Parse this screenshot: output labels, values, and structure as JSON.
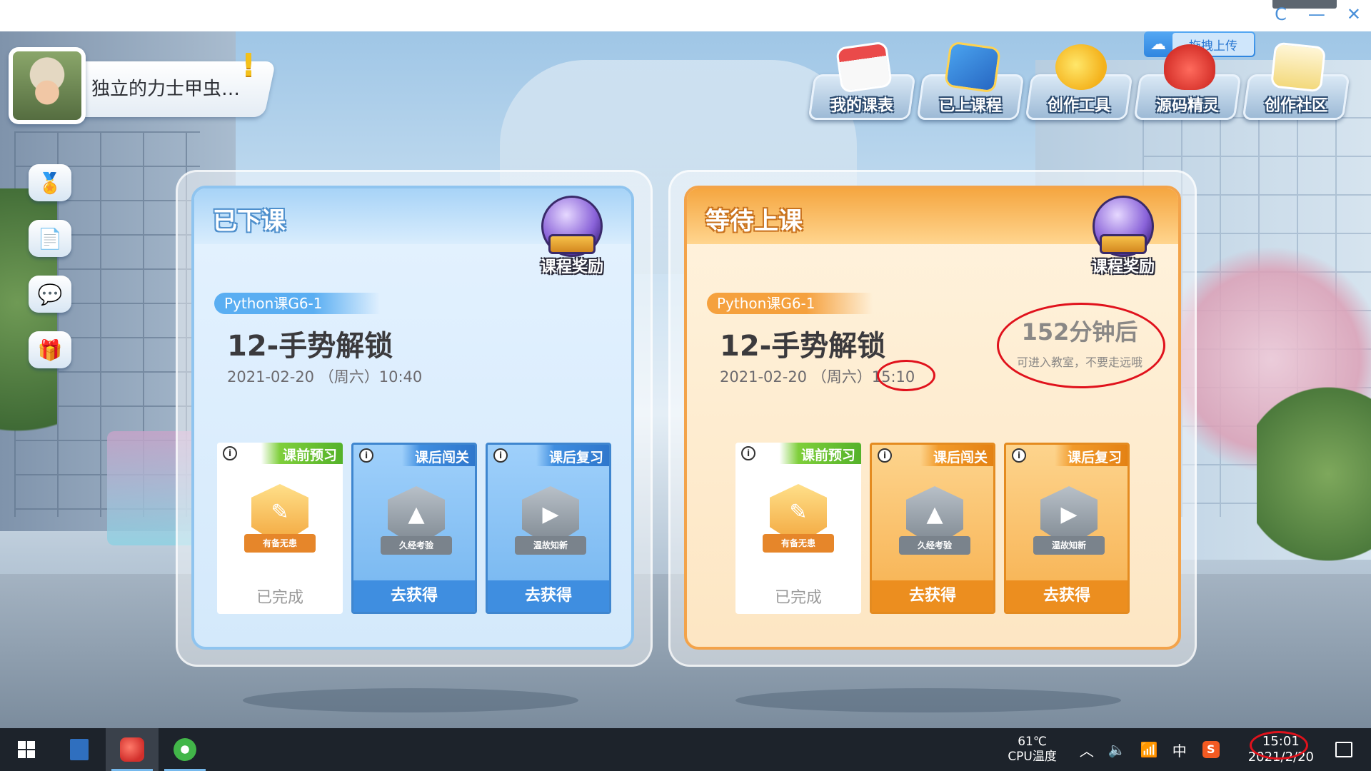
{
  "window": {
    "minimize": "—",
    "close": "✕",
    "refresh": "C"
  },
  "player": {
    "name": "独立的力士甲虫…",
    "alert": "!"
  },
  "upload": {
    "label": "拖拽上传"
  },
  "top_menu": [
    {
      "label": "我的课表",
      "icon": "calendar-icon"
    },
    {
      "label": "已上课程",
      "icon": "book-icon"
    },
    {
      "label": "创作工具",
      "icon": "tools-icon"
    },
    {
      "label": "源码精灵",
      "icon": "sprite-icon"
    },
    {
      "label": "创作社区",
      "icon": "star-icon"
    }
  ],
  "side_icons": [
    "medal-icon",
    "document-icon",
    "chat-icon",
    "gift-icon"
  ],
  "panels": [
    {
      "title": "已下课",
      "reward_label": "课程奖励",
      "course_tag": "Python课G6-1",
      "lesson_title": "12-手势解锁",
      "date": "2021-02-20 （周六）",
      "time": "10:40",
      "cards": [
        {
          "type": "课前预习",
          "status": "已完成",
          "badge": "有备无患",
          "style": "white"
        },
        {
          "type": "课后闯关",
          "status": "去获得",
          "badge": "久经考验",
          "style": "blue"
        },
        {
          "type": "课后复习",
          "status": "去获得",
          "badge": "温故知新",
          "style": "blue"
        }
      ]
    },
    {
      "title": "等待上课",
      "reward_label": "课程奖励",
      "course_tag": "Python课G6-1",
      "lesson_title": "12-手势解锁",
      "date": "2021-02-20 （周六）",
      "time": "15:10",
      "countdown": "152分钟后",
      "countdown_note": "可进入教室，不要走远哦",
      "cards": [
        {
          "type": "课前预习",
          "status": "已完成",
          "badge": "有备无患",
          "style": "white"
        },
        {
          "type": "课后闯关",
          "status": "去获得",
          "badge": "久经考验",
          "style": "orange"
        },
        {
          "type": "课后复习",
          "status": "去获得",
          "badge": "温故知新",
          "style": "orange"
        }
      ]
    }
  ],
  "taskbar": {
    "cpu_temp": "61℃",
    "cpu_label": "CPU温度",
    "ime": "中",
    "time": "15:01",
    "date": "2021/2/20"
  },
  "colors": {
    "highlight_ring": "#e0121c",
    "blue_panel": "#8fc4ef",
    "orange_panel": "#f3a34a"
  }
}
